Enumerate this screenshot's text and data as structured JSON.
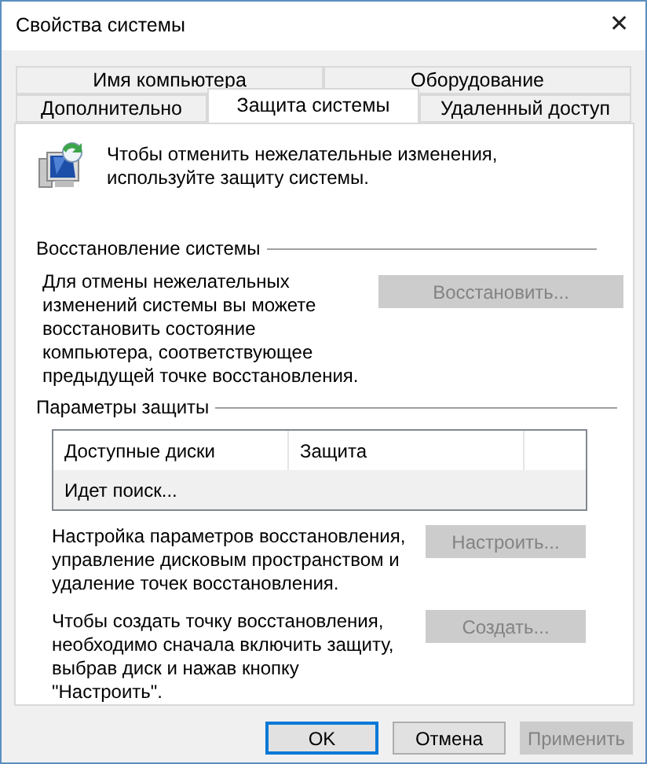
{
  "window": {
    "title": "Свойства системы",
    "close": "✕"
  },
  "tab_rows": [
    {
      "tabs": [
        {
          "label": "Имя компьютера",
          "selected": false
        },
        {
          "label": "Оборудование",
          "selected": false
        }
      ]
    },
    {
      "tabs": [
        {
          "label": "Дополнительно",
          "selected": false
        },
        {
          "label": "Защита системы",
          "selected": true
        },
        {
          "label": "Удаленный доступ",
          "selected": false
        }
      ]
    }
  ],
  "intro": "Чтобы отменить нежелательные изменения, используйте защиту системы.",
  "restore": {
    "heading": "Восстановление системы",
    "description": "Для отмены нежелательных изменений системы вы можете восстановить состояние компьютера, соответствующее предыдущей точке восстановления.",
    "button": {
      "label": "Восстановить...",
      "disabled": true
    }
  },
  "protection": {
    "heading": "Параметры защиты",
    "table": {
      "columns": [
        "Доступные диски",
        "Защита"
      ],
      "status": "Идет поиск..."
    },
    "actions": [
      {
        "description": "Настройка параметров восстановления, управление дисковым пространством и удаление точек восстановления.",
        "button": {
          "label": "Настроить...",
          "disabled": true
        }
      },
      {
        "description": "Чтобы создать точку восстановления, необходимо сначала включить защиту, выбрав диск и нажав кнопку \"Настроить\".",
        "button": {
          "label": "Создать...",
          "disabled": true
        }
      }
    ]
  },
  "buttons": [
    {
      "label": "OK",
      "default": true,
      "disabled": false
    },
    {
      "label": "Отмена",
      "default": false,
      "disabled": false
    },
    {
      "label": "Применить",
      "default": false,
      "disabled": true
    }
  ]
}
